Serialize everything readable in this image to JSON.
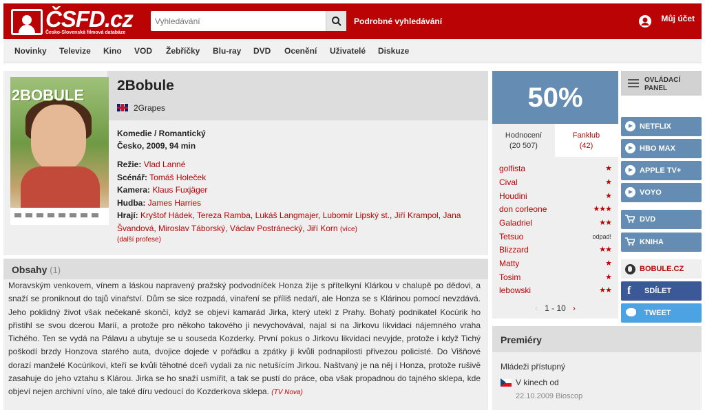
{
  "header": {
    "logo_text": "ČSFD.cz",
    "logo_tagline": "Česko-Slovenská filmová databáze",
    "search_placeholder": "Vyhledávání",
    "advanced_search": "Podrobné vyhledávání",
    "account": "Můj účet",
    "brand_color": "#ba0305"
  },
  "nav": [
    "Novinky",
    "Televize",
    "Kino",
    "VOD",
    "Žebříčky",
    "Blu-ray",
    "DVD",
    "Ocenění",
    "Uživatelé",
    "Diskuze"
  ],
  "film": {
    "title": "2Bobule",
    "poster_title": "2BOBULE",
    "alt_title": "2Grapes",
    "genre": "Komedie / Romantický",
    "origin": "Česko, 2009, 94 min",
    "director_label": "Režie:",
    "director": "Vlad Lanné",
    "writer_label": "Scénář:",
    "writer": "Tomáš Holeček",
    "camera_label": "Kamera:",
    "camera": "Klaus Fuxjäger",
    "music_label": "Hudba:",
    "music": "James Harries",
    "cast_label": "Hrají:",
    "cast": [
      "Kryštof Hádek",
      "Tereza Ramba",
      "Lukáš Langmajer",
      "Lubomír Lipský st.",
      "Jiří Krampol",
      "Jana Švandová",
      "Miroslav Táborský",
      "Václav Postránecký",
      "Jiří Korn"
    ],
    "cast_more": "(více)",
    "more_professions": "(další profese)"
  },
  "plot": {
    "heading": "Obsahy",
    "count": "(1)",
    "text": "Moravským venkovem, vínem a láskou napravený pražský podvodníček Honza žije s přítelkyní Klárkou v chalupě po dědovi, a snaží se proniknout do tajů vinařství. Dům se sice rozpadá, vinaření se příliš nedaří, ale Honza se s Klárinou pomocí nevzdává. Jeho poklidný život však nečekaně skončí, když se objeví kamarád Jirka, který utekl z Prahy. Bohatý podnikatel Kocúrik ho přistihl se svou dcerou Marií, a protože pro někoho takového ji nevychovával, najal si na Jirkovu likvidaci nájemného vraha Tichého. Ten se vydá na Pálavu a ubytuje se u souseda Kozderky. První pokus o Jirkovu likvidaci nevyjde, protože i když Tichý poškodí brzdy Honzova starého auta, dvojice dojede v pořádku a zpátky ji kvůli podnapilosti přivezou policisté. Do Višňové dorazí manželé Kocúrikovi, kteří se kvůli těhotné dceři vydali za nic netušícím Jirkou. Naštvaný je na něj i Honza, protože rušivě zasahuje do jeho vztahu s Klárou. Jirka se ho snaží usmířit, a tak se pustí do práce, oba však propadnou do tajného sklepa, kde objeví nejen archivní víno, ale také díru vedoucí do Kozderkova sklepa.",
    "source": "(TV Nova)"
  },
  "rating": {
    "percent": "50%",
    "tab_ratings": "Hodnocení",
    "tab_ratings_count": "(20 507)",
    "tab_fanclub": "Fanklub",
    "tab_fanclub_count": "(42)",
    "users": [
      {
        "name": "golfista",
        "stars": "★"
      },
      {
        "name": "Cival",
        "stars": "★"
      },
      {
        "name": "Houdini",
        "stars": "★"
      },
      {
        "name": "don corleone",
        "stars": "★★★"
      },
      {
        "name": "Galadriel",
        "stars": "★★"
      },
      {
        "name": "Tetsuo",
        "stars": "odpad!"
      },
      {
        "name": "Blizzard",
        "stars": "★★"
      },
      {
        "name": "Matty",
        "stars": "★"
      },
      {
        "name": "Tosim",
        "stars": "★"
      },
      {
        "name": "lebowski",
        "stars": "★★"
      }
    ],
    "pager": "1 - 10",
    "pager_prev": "‹",
    "pager_next": "›",
    "panel_color": "#658db4"
  },
  "sidebar": {
    "control_panel": "OVLÁDACÍ PANEL",
    "vod": [
      "NETFLIX",
      "HBO MAX",
      "APPLE TV+",
      "VOYO"
    ],
    "shop": [
      "DVD",
      "KNIHA"
    ],
    "website": "BOBULE.CZ",
    "share": "SDÍLET",
    "tweet": "TWEET"
  },
  "premieres": {
    "heading": "Premiéry",
    "rating": "Mládeži přístupný",
    "cinema_label": "V kinech od",
    "cinema_date": "22.10.2009 Bioscop"
  }
}
